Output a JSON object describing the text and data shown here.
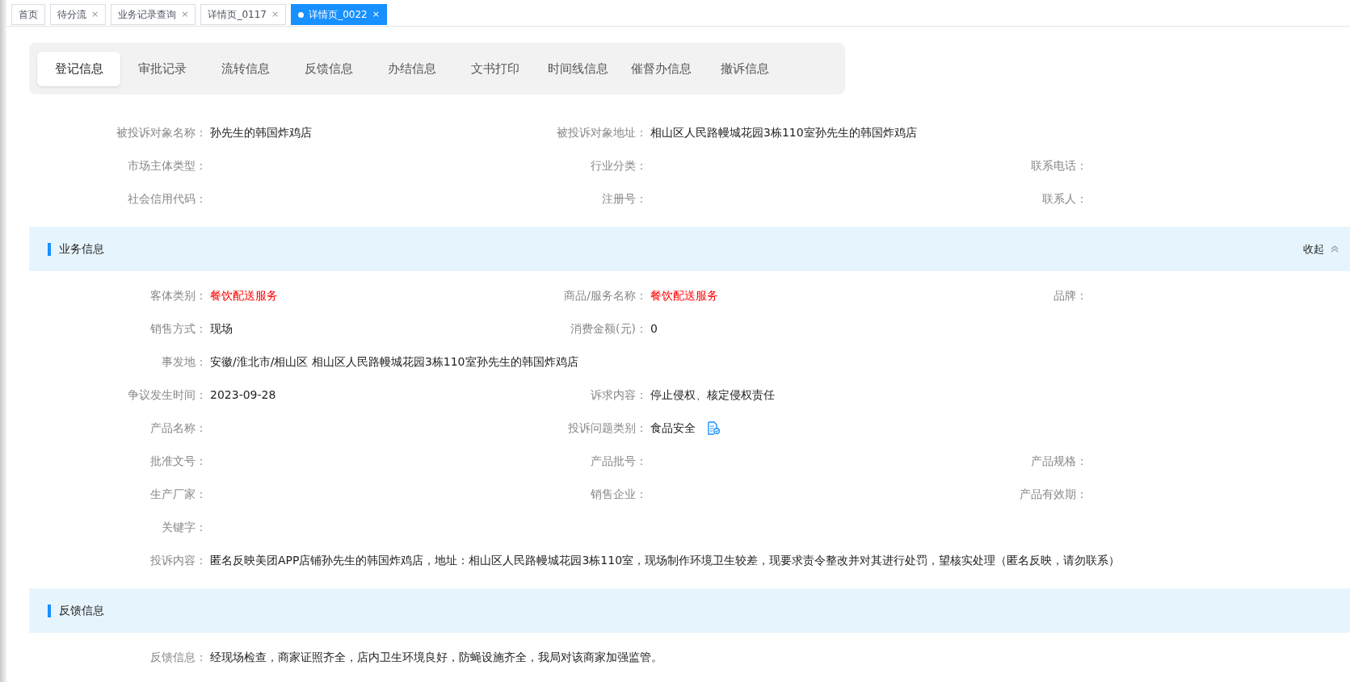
{
  "page_tabs": [
    {
      "label": "首页",
      "closable": false,
      "selected": false
    },
    {
      "label": "待分流",
      "closable": true,
      "selected": false
    },
    {
      "label": "业务记录查询",
      "closable": true,
      "selected": false
    },
    {
      "label": "详情页_0117",
      "closable": true,
      "selected": false
    },
    {
      "label": "详情页_0022",
      "closable": true,
      "selected": true
    }
  ],
  "close_glyph": "×",
  "section_tabs": [
    {
      "label": "登记信息",
      "selected": true
    },
    {
      "label": "审批记录",
      "selected": false
    },
    {
      "label": "流转信息",
      "selected": false
    },
    {
      "label": "反馈信息",
      "selected": false
    },
    {
      "label": "办结信息",
      "selected": false
    },
    {
      "label": "文书打印",
      "selected": false
    },
    {
      "label": "时间线信息",
      "selected": false
    },
    {
      "label": "催督办信息",
      "selected": false
    },
    {
      "label": "撤诉信息",
      "selected": false
    }
  ],
  "sections": [
    {
      "rows": [
        [
          {
            "label": "被投诉对象名称：",
            "value": "孙先生的韩国炸鸡店"
          },
          {
            "label": "被投诉对象地址：",
            "value": "相山区人民路幔城花园3栋110室孙先生的韩国炸鸡店"
          }
        ],
        [
          {
            "label": "市场主体类型："
          },
          {
            "label": "行业分类："
          },
          {
            "label": "联系电话："
          }
        ],
        [
          {
            "label": "社会信用代码："
          },
          {
            "label": "注册号："
          },
          {
            "label": "联系人："
          }
        ]
      ]
    },
    {
      "title": "业务信息",
      "toggle": "收起",
      "rows": [
        [
          {
            "label": "客体类别：",
            "value": "餐饮配送服务",
            "color": "#ff0000"
          },
          {
            "label": "商品/服务名称：",
            "value": "餐饮配送服务",
            "color": "#ff0000"
          },
          {
            "label": "品牌："
          }
        ],
        [
          {
            "label": "销售方式：",
            "value": "现场"
          },
          {
            "label": "消费金额(元)：",
            "value": "0"
          }
        ],
        [
          {
            "label": "事发地：",
            "value": "安徽/淮北市/相山区 相山区人民路幔城花园3栋110室孙先生的韩国炸鸡店"
          }
        ],
        [
          {
            "label": "争议发生时间：",
            "value": "2023-09-28"
          },
          {
            "label": "诉求内容：",
            "value": "停止侵权、核定侵权责任"
          }
        ],
        [
          {
            "label": "产品名称："
          },
          {
            "label": "投诉问题类别：",
            "value": "食品安全",
            "kind": "with-icon"
          }
        ],
        [
          {
            "label": "批准文号："
          },
          {
            "label": "产品批号："
          },
          {
            "label": "产品规格："
          }
        ],
        [
          {
            "label": "生产厂家："
          },
          {
            "label": "销售企业："
          },
          {
            "label": "产品有效期："
          }
        ],
        [
          {
            "label": "关键字："
          }
        ],
        [
          {
            "label": "投诉内容：",
            "value": "匿名反映美团APP店铺孙先生的韩国炸鸡店，地址：相山区人民路幔城花园3栋110室，现场制作环境卫生较差，现要求责令整改并对其进行处罚，望核实处理（匿名反映，请勿联系）"
          }
        ]
      ]
    },
    {
      "title": "反馈信息",
      "rows": [
        [
          {
            "label": "反馈信息：",
            "value": "经现场检查，商家证照齐全，店内卫生环境良好，防蝇设施齐全，我局对该商家加强监管。"
          }
        ]
      ]
    }
  ]
}
